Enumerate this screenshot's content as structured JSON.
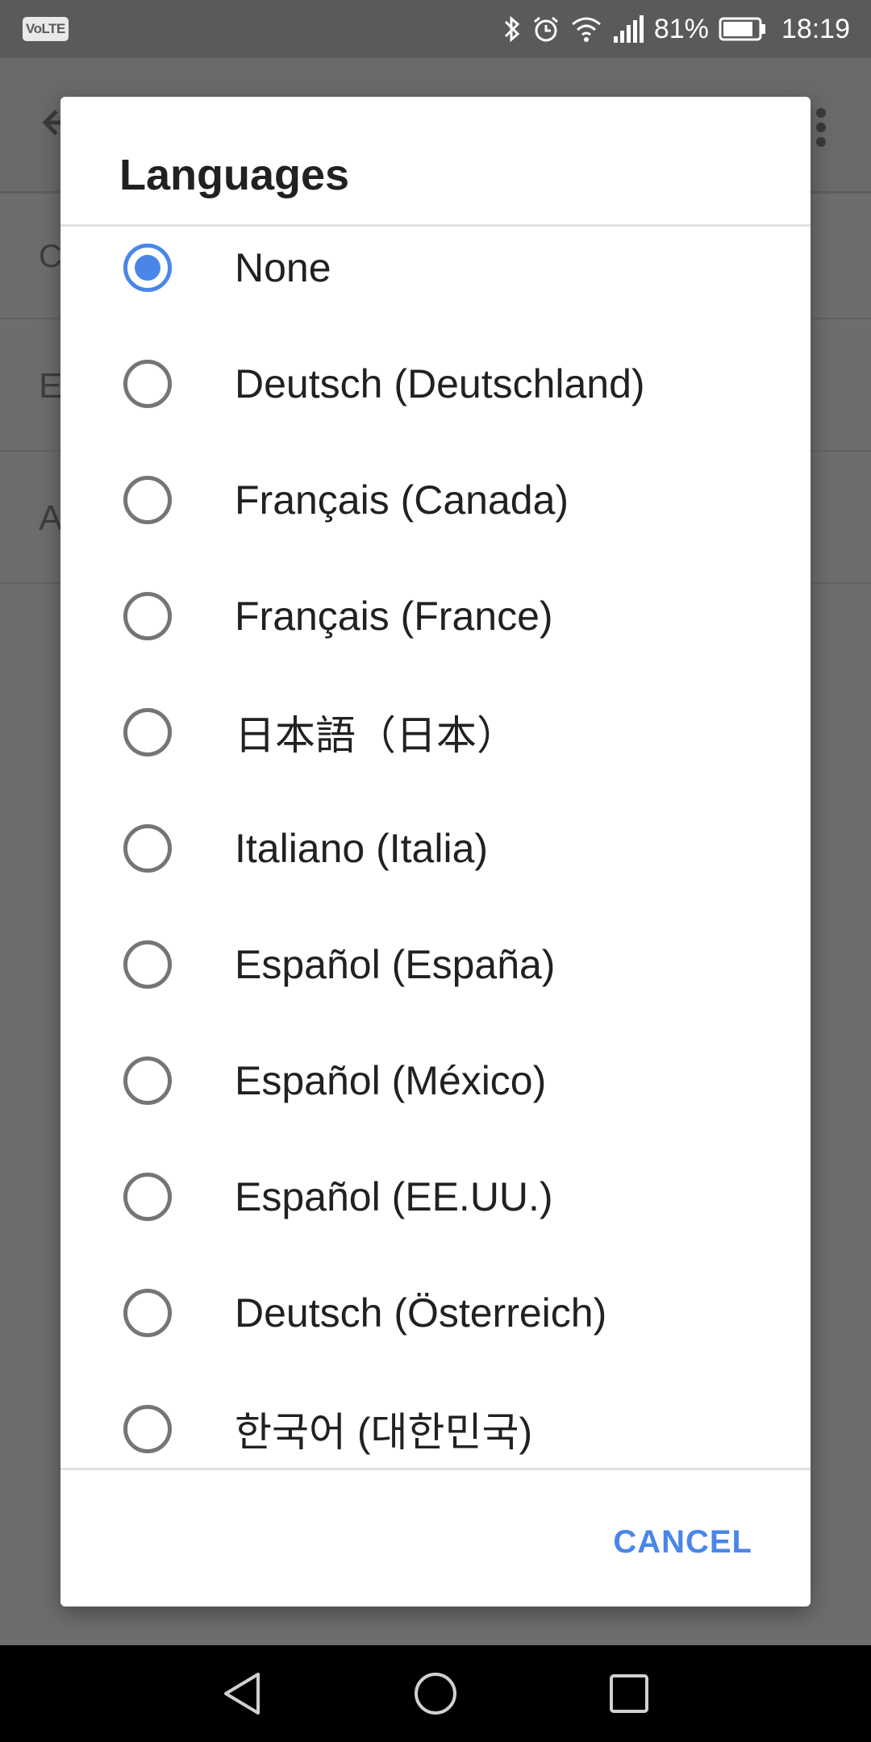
{
  "status_bar": {
    "volte": "VoLTE",
    "battery_percent": "81%",
    "time": "18:19",
    "icons": [
      "bluetooth-icon",
      "alarm-icon",
      "wifi-icon",
      "signal-icon",
      "battery-icon"
    ]
  },
  "background": {
    "rows": [
      "C",
      "E",
      "A"
    ]
  },
  "dialog": {
    "title": "Languages",
    "options": [
      {
        "label": "None",
        "checked": true
      },
      {
        "label": "Deutsch (Deutschland)",
        "checked": false
      },
      {
        "label": "Français (Canada)",
        "checked": false
      },
      {
        "label": "Français (France)",
        "checked": false
      },
      {
        "label": "日本語（日本）",
        "checked": false
      },
      {
        "label": "Italiano (Italia)",
        "checked": false
      },
      {
        "label": "Español (España)",
        "checked": false
      },
      {
        "label": "Español (México)",
        "checked": false
      },
      {
        "label": "Español (EE.UU.)",
        "checked": false
      },
      {
        "label": "Deutsch (Österreich)",
        "checked": false
      },
      {
        "label": "한국어 (대한민국)",
        "checked": false
      }
    ],
    "cancel_label": "CANCEL"
  },
  "colors": {
    "accent": "#4a86e8",
    "scrim": "#6b6b6b"
  },
  "nav_bar": {
    "icons": [
      "back-icon",
      "home-icon",
      "recents-icon"
    ]
  }
}
